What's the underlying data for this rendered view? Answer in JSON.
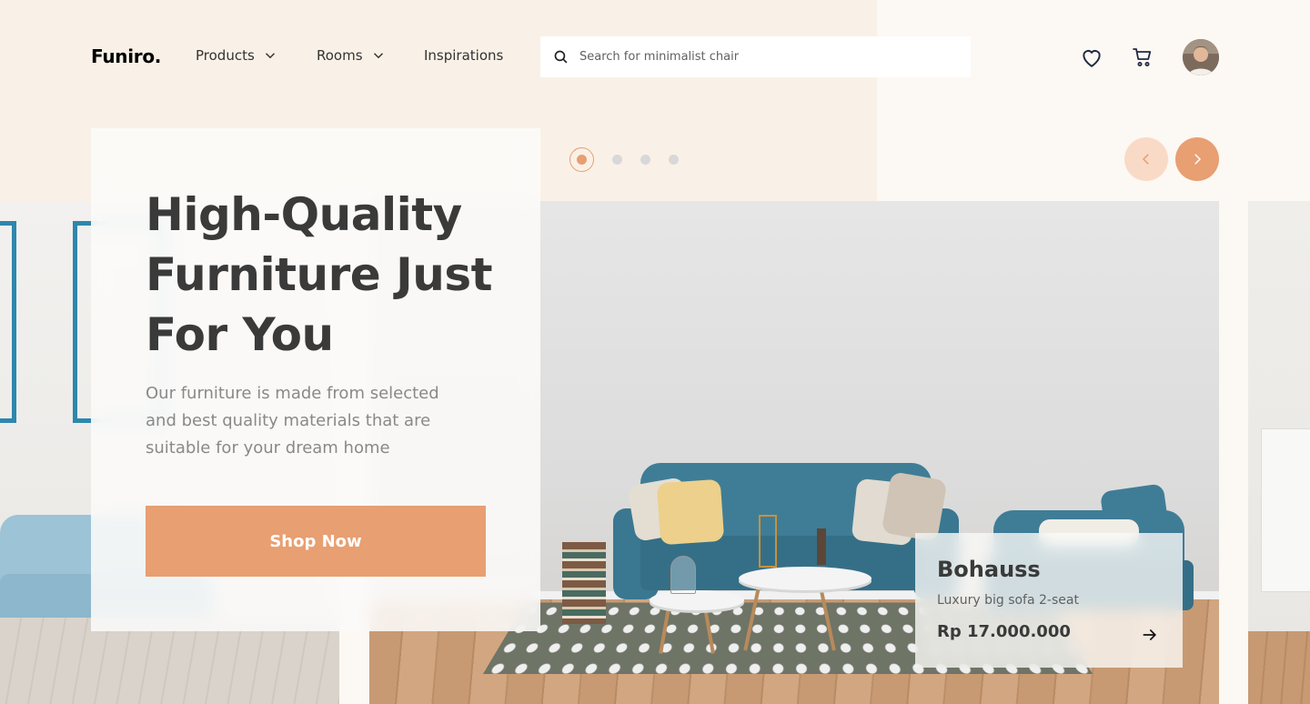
{
  "brand": {
    "logo": "Funiro."
  },
  "nav": {
    "items": [
      {
        "label": "Products",
        "has_dropdown": true
      },
      {
        "label": "Rooms",
        "has_dropdown": true
      },
      {
        "label": "Inspirations",
        "has_dropdown": false
      }
    ]
  },
  "search": {
    "placeholder": "Search for minimalist chair",
    "icon": "search-icon"
  },
  "header_icons": [
    "heart-icon",
    "cart-icon",
    "avatar"
  ],
  "hero": {
    "title": "High-Quality Furniture Just For You",
    "description": "Our furniture is made from selected and best quality materials that are suitable for your dream home",
    "cta_label": "Shop Now"
  },
  "slider": {
    "total_slides": 4,
    "active_index": 0,
    "prev_icon": "chevron-left-icon",
    "next_icon": "chevron-right-icon"
  },
  "featured_product": {
    "name": "Bohauss",
    "description": "Luxury big sofa 2-seat",
    "price": "Rp 17.000.000",
    "icon": "arrow-right-icon"
  },
  "colors": {
    "accent": "#e89f71",
    "accent_light": "#f9dac6",
    "peach_bg": "#f9f1e7",
    "page_bg": "#fcf8f3",
    "heading": "#3a3a3a",
    "body_text": "#898989"
  }
}
